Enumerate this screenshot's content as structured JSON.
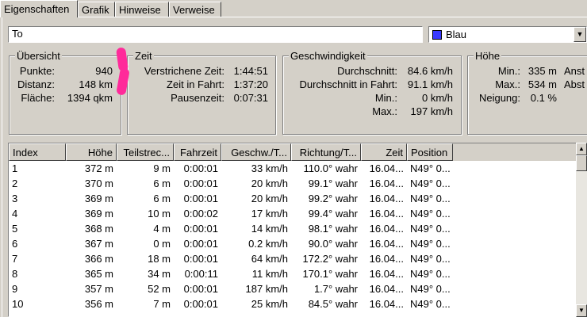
{
  "tabs": [
    {
      "label": "Eigenschaften",
      "active": true
    },
    {
      "label": "Grafik",
      "active": false
    },
    {
      "label": "Hinweise",
      "active": false
    },
    {
      "label": "Verweise",
      "active": false
    }
  ],
  "name_field": {
    "value": "To"
  },
  "color_select": {
    "value": "Blau",
    "swatch": "#3a3aff"
  },
  "overview": {
    "title": "Übersicht",
    "rows": [
      {
        "label": "Punkte:",
        "value": "940"
      },
      {
        "label": "Distanz:",
        "value": "148 km"
      },
      {
        "label": "Fläche:",
        "value": "1394 qkm"
      }
    ]
  },
  "time": {
    "title": "Zeit",
    "rows": [
      {
        "label": "Verstrichene Zeit:",
        "value": "1:44:51"
      },
      {
        "label": "Zeit in Fahrt:",
        "value": "1:37:20"
      },
      {
        "label": "Pausenzeit:",
        "value": "0:07:31"
      }
    ]
  },
  "speed": {
    "title": "Geschwindigkeit",
    "rows": [
      {
        "label": "Durchschnitt:",
        "value": "84.6 km/h"
      },
      {
        "label": "Durchschnitt in Fahrt:",
        "value": "91.1 km/h"
      },
      {
        "label": "Min.:",
        "value": "0 km/h"
      },
      {
        "label": "Max.:",
        "value": "197 km/h"
      }
    ]
  },
  "height": {
    "title": "Höhe",
    "rows": [
      {
        "label": "Min.:",
        "value": "335 m",
        "extra": "Anst"
      },
      {
        "label": "Max.:",
        "value": "534 m",
        "extra": "Abst"
      },
      {
        "label": "Neigung:",
        "value": "0.1 %",
        "extra": ""
      }
    ]
  },
  "table": {
    "columns": [
      "Index",
      "Höhe",
      "Teilstrec...",
      "Fahrzeit",
      "Geschw./T...",
      "Richtung/T...",
      "Zeit",
      "Position"
    ],
    "rows": [
      [
        "1",
        "372 m",
        "9 m",
        "0:00:01",
        "33 km/h",
        "110.0° wahr",
        "16.04...",
        "N49° 0..."
      ],
      [
        "2",
        "370 m",
        "6 m",
        "0:00:01",
        "20 km/h",
        "99.1° wahr",
        "16.04...",
        "N49° 0..."
      ],
      [
        "3",
        "369 m",
        "6 m",
        "0:00:01",
        "20 km/h",
        "99.2° wahr",
        "16.04...",
        "N49° 0..."
      ],
      [
        "4",
        "369 m",
        "10 m",
        "0:00:02",
        "17 km/h",
        "99.4° wahr",
        "16.04...",
        "N49° 0..."
      ],
      [
        "5",
        "368 m",
        "4 m",
        "0:00:01",
        "14 km/h",
        "98.1° wahr",
        "16.04...",
        "N49° 0..."
      ],
      [
        "6",
        "367 m",
        "0 m",
        "0:00:01",
        "0.2 km/h",
        "90.0° wahr",
        "16.04...",
        "N49° 0..."
      ],
      [
        "7",
        "366 m",
        "18 m",
        "0:00:01",
        "64 km/h",
        "172.2° wahr",
        "16.04...",
        "N49° 0..."
      ],
      [
        "8",
        "365 m",
        "34 m",
        "0:00:11",
        "11 km/h",
        "170.1° wahr",
        "16.04...",
        "N49° 0..."
      ],
      [
        "9",
        "357 m",
        "52 m",
        "0:00:01",
        "187 km/h",
        "1.7° wahr",
        "16.04...",
        "N49° 0..."
      ],
      [
        "10",
        "356 m",
        "7 m",
        "0:00:01",
        "25 km/h",
        "84.5° wahr",
        "16.04...",
        "N49° 0..."
      ]
    ]
  }
}
